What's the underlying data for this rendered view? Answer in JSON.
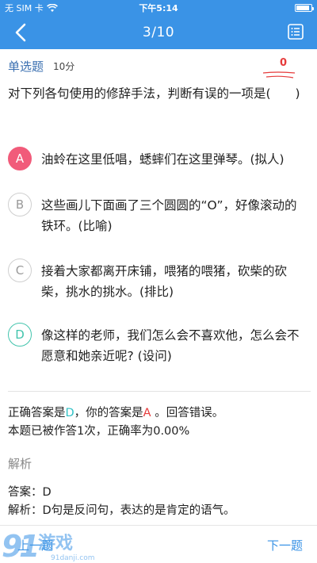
{
  "status_bar": {
    "carrier": "无 SIM 卡",
    "time": "下午5:14",
    "wifi_icon": "wifi-icon",
    "battery_icon": "battery-icon"
  },
  "nav": {
    "title": "3/10",
    "back_icon": "chevron-left-icon",
    "menu_icon": "list-menu-icon"
  },
  "question": {
    "type": "单选题",
    "score": "10分",
    "wrong_count": "0",
    "stem": "对下列各句使用的修辞手法，判断有误的一项是(　　)"
  },
  "options": [
    {
      "letter": "A",
      "text": "油蛉在这里低唱，蟋蟀们在这里弹琴。(拟人)",
      "state": "selected"
    },
    {
      "letter": "B",
      "text": "这些画儿下面画了三个圆圆的“O”，好像滚动的铁环。(比喻)",
      "state": "normal"
    },
    {
      "letter": "C",
      "text": "接着大家都离开床铺，喂猪的喂猪，砍柴的砍柴，挑水的挑水。(排比)",
      "state": "normal"
    },
    {
      "letter": "D",
      "text": "像这样的老师，我们怎么会不喜欢他，怎么会不愿意和她亲近呢? (设问)",
      "state": "correct"
    }
  ],
  "result": {
    "correct_prefix": "正确答案是",
    "correct_answer": "D",
    "your_prefix": "，你的答案是",
    "your_answer": "A",
    "verdict": " 。回答错误。",
    "stats": "本题已被作答1次，正确率为0.00%"
  },
  "analysis": {
    "title": "解析",
    "answer_line": "答案：D",
    "explanation": "解析：D句是反问句，表达的是肯定的语气。"
  },
  "footer": {
    "prev_label": "上一题",
    "next_label": "下一题"
  },
  "colors": {
    "header": "#3a93e6",
    "selected": "#f15b7a",
    "correct": "#43c4ad",
    "wrong": "#e63b3b"
  }
}
